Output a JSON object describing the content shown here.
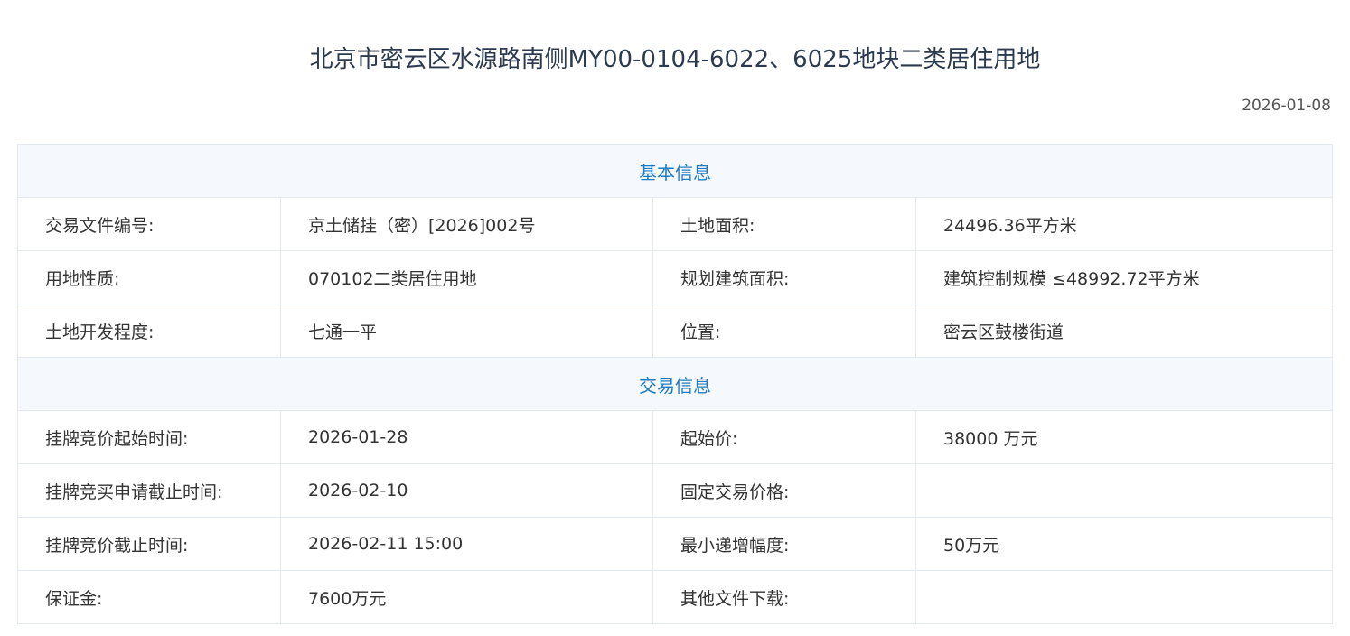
{
  "page": {
    "title": "北京市密云区水源路南侧MY00-0104-6022、6025地块二类居住用地",
    "date": "2026-01-08"
  },
  "basic_info": {
    "header": "基本信息",
    "rows": [
      [
        "交易文件编号:",
        "京土储挂（密）[2026]002号",
        "土地面积:",
        "24496.36平方米"
      ],
      [
        "用地性质:",
        "070102二类居住用地",
        "规划建筑面积:",
        "建筑控制规模 ≤48992.72平方米"
      ],
      [
        "土地开发程度:",
        "七通一平",
        "位置:",
        "密云区鼓楼街道"
      ]
    ]
  },
  "trade_info": {
    "header": "交易信息",
    "rows": [
      [
        "挂牌竞价起始时间:",
        "2026-01-28",
        "起始价:",
        "38000 万元"
      ],
      [
        "挂牌竞买申请截止时间:",
        "2026-02-10",
        "固定交易价格:",
        ""
      ],
      [
        "挂牌竞价截止时间:",
        "2026-02-11 15:00",
        "最小递增幅度:",
        "50万元"
      ],
      [
        "保证金:",
        "7600万元",
        "其他文件下载:",
        ""
      ]
    ]
  }
}
